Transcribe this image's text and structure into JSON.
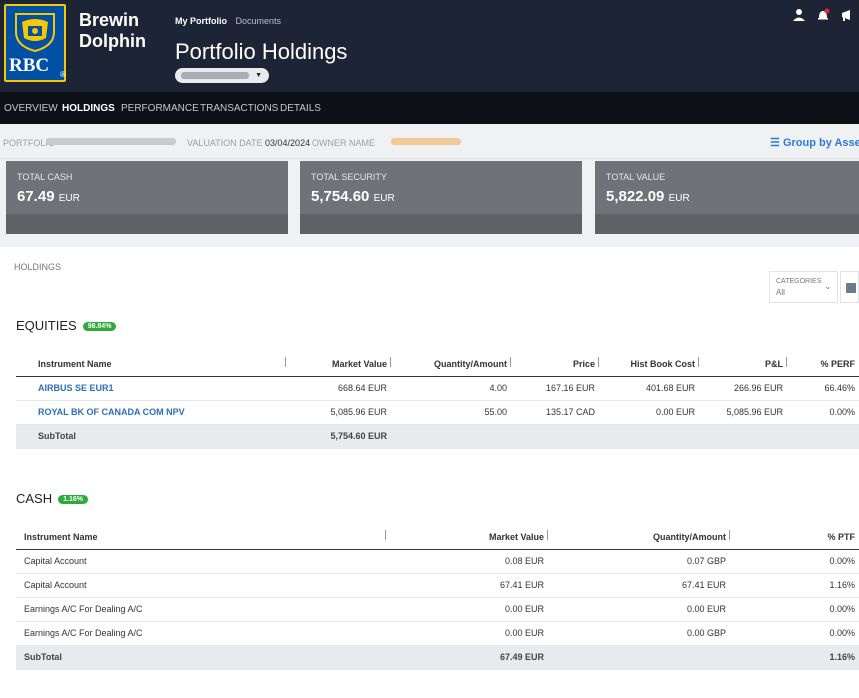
{
  "brand": {
    "logo_text": "RBC",
    "name_line1": "Brewin",
    "name_line2": "Dolphin",
    "colors": {
      "primary_blue": "#0051a5",
      "gold": "#f5c800",
      "header_bg": "#1c2436"
    }
  },
  "top_nav": {
    "active": "My Portfolio",
    "link": "Documents"
  },
  "page_title": "Portfolio Holdings",
  "header_icons": [
    "user-icon",
    "notification-bell-icon",
    "megaphone-icon"
  ],
  "tabs": [
    "OVERVIEW",
    "HOLDINGS",
    "PERFORMANCE",
    "TRANSACTIONS",
    "DETAILS"
  ],
  "active_tab": "HOLDINGS",
  "info": {
    "portfolio_label": "PORTFOLIO",
    "valuation_label": "VALUATION DATE",
    "valuation_date": "03/04/2024",
    "owner_label": "OWNER NAME",
    "group_by": "Group by Asse"
  },
  "cards": [
    {
      "label": "TOTAL CASH",
      "value": "67.49",
      "unit": "EUR"
    },
    {
      "label": "TOTAL SECURITY",
      "value": "5,754.60",
      "unit": "EUR"
    },
    {
      "label": "TOTAL VALUE",
      "value": "5,822.09",
      "unit": "EUR"
    }
  ],
  "holdings": {
    "section_label": "HOLDINGS",
    "categories_label": "CATEGORIES",
    "categories_value": "All"
  },
  "equities": {
    "title": "EQUITIES",
    "badge": "98.84%",
    "columns": [
      "Instrument Name",
      "Market Value",
      "Quantity/Amount",
      "Price",
      "Hist Book Cost",
      "P&L",
      "% PERF"
    ],
    "rows": [
      [
        "AIRBUS SE EUR1",
        "668.64 EUR",
        "4.00",
        "167.16 EUR",
        "401.68 EUR",
        "266.96 EUR",
        "66.46%"
      ],
      [
        "ROYAL BK OF CANADA COM NPV",
        "5,085.96 EUR",
        "55.00",
        "135.17 CAD",
        "0.00 EUR",
        "5,085.96 EUR",
        "0.00%"
      ]
    ],
    "subtotal": {
      "label": "SubTotal",
      "market_value": "5,754.60 EUR"
    }
  },
  "cash": {
    "title": "CASH",
    "badge": "1.16%",
    "columns": [
      "Instrument Name",
      "Market Value",
      "Quantity/Amount",
      "% PTF"
    ],
    "rows": [
      [
        "Capital Account",
        "0.08 EUR",
        "0.07 GBP",
        "0.00%"
      ],
      [
        "Capital Account",
        "67.41 EUR",
        "67.41 EUR",
        "1.16%"
      ],
      [
        "Earnings A/C For Dealing A/C",
        "0.00 EUR",
        "0.00 EUR",
        "0.00%"
      ],
      [
        "Earnings A/C For Dealing A/C",
        "0.00 EUR",
        "0.00 GBP",
        "0.00%"
      ]
    ],
    "subtotal": {
      "label": "SubTotal",
      "market_value": "67.49 EUR",
      "ptf": "1.16%"
    }
  }
}
